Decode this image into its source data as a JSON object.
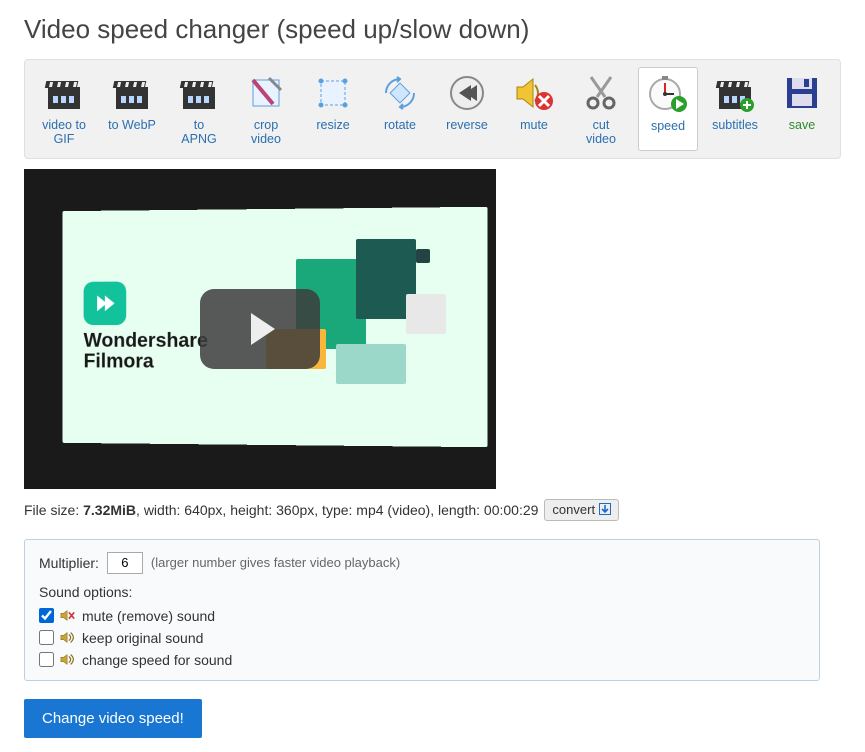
{
  "title": "Video speed changer (speed up/slow down)",
  "toolbar": [
    {
      "id": "video-to-gif",
      "label": "video to GIF"
    },
    {
      "id": "to-webp",
      "label": "to WebP"
    },
    {
      "id": "to-apng",
      "label": "to APNG"
    },
    {
      "id": "crop-video",
      "label": "crop video"
    },
    {
      "id": "resize",
      "label": "resize"
    },
    {
      "id": "rotate",
      "label": "rotate"
    },
    {
      "id": "reverse",
      "label": "reverse"
    },
    {
      "id": "mute",
      "label": "mute"
    },
    {
      "id": "cut-video",
      "label": "cut video"
    },
    {
      "id": "speed",
      "label": "speed",
      "active": true
    },
    {
      "id": "subtitles",
      "label": "subtitles"
    },
    {
      "id": "save",
      "label": "save",
      "green": true
    }
  ],
  "video": {
    "brand_line1": "Wondershare",
    "brand_line2": "Filmora"
  },
  "meta": {
    "prefix": "File size: ",
    "size": "7.32MiB",
    "rest": ", width: 640px, height: 360px, type: mp4 (video), length: 00:00:29",
    "convert": "convert"
  },
  "panel": {
    "multiplier_label": "Multiplier:",
    "multiplier_value": "6",
    "hint": "(larger number gives faster video playback)",
    "sound_heading": "Sound options:",
    "opts": [
      {
        "id": "mute-sound",
        "label": "mute (remove) sound",
        "checked": true
      },
      {
        "id": "keep-sound",
        "label": "keep original sound",
        "checked": false
      },
      {
        "id": "speedsound",
        "label": "change speed for sound",
        "checked": false
      }
    ]
  },
  "cta": "Change video speed!"
}
